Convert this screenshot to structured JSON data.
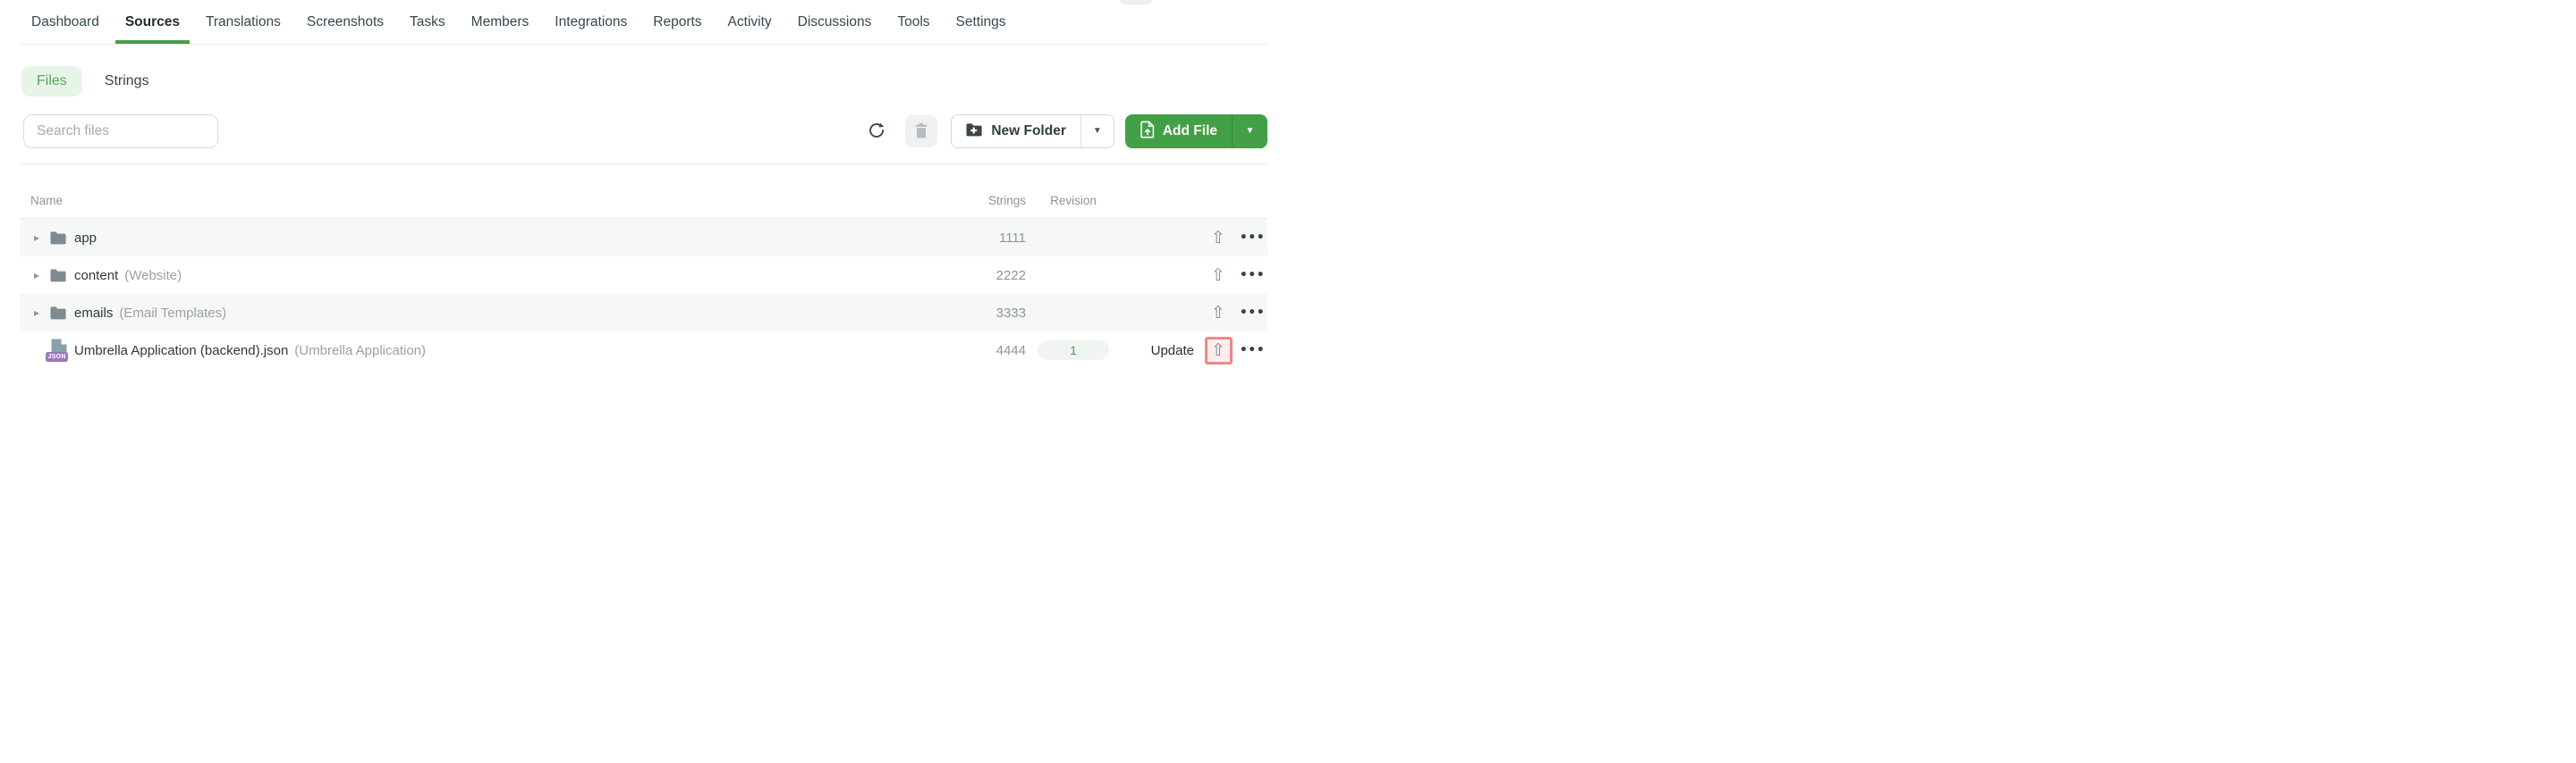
{
  "topnav": {
    "items": [
      {
        "label": "Dashboard",
        "active": false
      },
      {
        "label": "Sources",
        "active": true
      },
      {
        "label": "Translations",
        "active": false
      },
      {
        "label": "Screenshots",
        "active": false
      },
      {
        "label": "Tasks",
        "active": false
      },
      {
        "label": "Members",
        "active": false
      },
      {
        "label": "Integrations",
        "active": false
      },
      {
        "label": "Reports",
        "active": false
      },
      {
        "label": "Activity",
        "active": false
      },
      {
        "label": "Discussions",
        "active": false
      },
      {
        "label": "Tools",
        "active": false
      },
      {
        "label": "Settings",
        "active": false
      }
    ]
  },
  "view_tabs": {
    "files_label": "Files",
    "strings_label": "Strings",
    "active": "Files"
  },
  "toolbar": {
    "search_placeholder": "Search files",
    "new_folder_label": "New Folder",
    "add_file_label": "Add File"
  },
  "table": {
    "columns": {
      "name": "Name",
      "strings": "Strings",
      "revision": "Revision"
    },
    "rows": [
      {
        "type": "folder",
        "name": "app",
        "secondary": "",
        "strings": "1111",
        "revision": "",
        "update_label": "",
        "upload_highlighted": false
      },
      {
        "type": "folder",
        "name": "content",
        "secondary": "(Website)",
        "strings": "2222",
        "revision": "",
        "update_label": "",
        "upload_highlighted": false
      },
      {
        "type": "folder",
        "name": "emails",
        "secondary": "(Email Templates)",
        "strings": "3333",
        "revision": "",
        "update_label": "",
        "upload_highlighted": false
      },
      {
        "type": "file",
        "name": "Umbrella Application (backend).json",
        "secondary": "(Umbrella Application)",
        "strings": "4444",
        "revision": "1",
        "update_label": "Update",
        "upload_highlighted": true
      }
    ]
  },
  "icons": {
    "expand_caret": "▸",
    "dropdown_caret": "▼",
    "upload": "⇧",
    "more": "•••"
  },
  "colors": {
    "accent_green": "#43a047",
    "files_tab_bg": "#e7f4e8",
    "files_tab_text": "#57a75b",
    "row_alt_bg": "#f6f7f7",
    "muted_text": "#8d959a",
    "highlight_border": "#ee8888",
    "highlight_bg": "#fdeded",
    "json_badge_purple": "#9b79b8",
    "folder_icon_gray": "#7e8b93",
    "doc_icon_gray_blue": "#8ba0ad"
  }
}
